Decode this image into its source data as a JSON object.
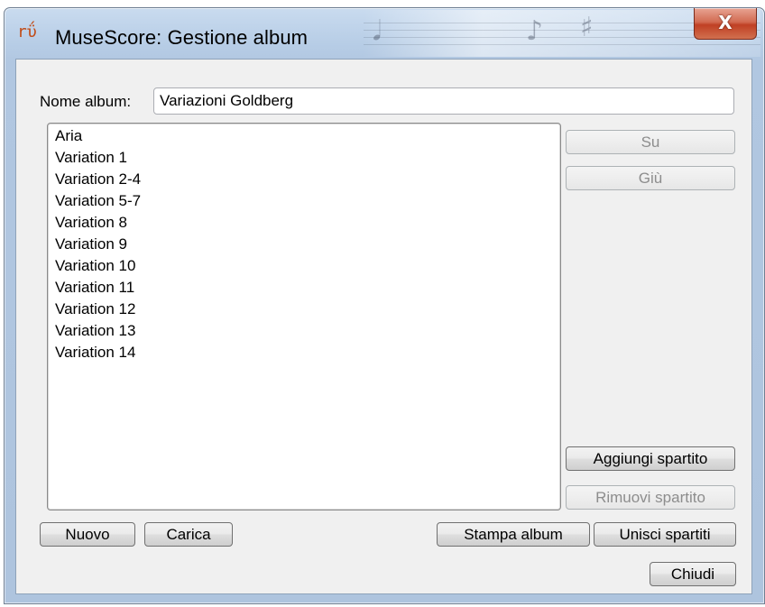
{
  "window": {
    "title": "MuseScore: Gestione album",
    "close_glyph": "X",
    "app_icon": "musescore-icon"
  },
  "album": {
    "name_label": "Nome album:",
    "name_value": "Variazioni Goldberg"
  },
  "scores": [
    "Aria",
    "Variation 1",
    "Variation 2-4",
    "Variation 5-7",
    "Variation 8",
    "Variation 9",
    "Variation 10",
    "Variation 11",
    "Variation 12",
    "Variation 13",
    "Variation 14"
  ],
  "buttons": {
    "up": "Su",
    "down": "Giù",
    "add_score": "Aggiungi spartito",
    "remove_score": "Rimuovi spartito",
    "new": "Nuovo",
    "load": "Carica",
    "print_album": "Stampa album",
    "join_scores": "Unisci spartiti",
    "close": "Chiudi"
  },
  "colors": {
    "close_button": "#c04024",
    "disabled_text": "#8d8d8d"
  }
}
